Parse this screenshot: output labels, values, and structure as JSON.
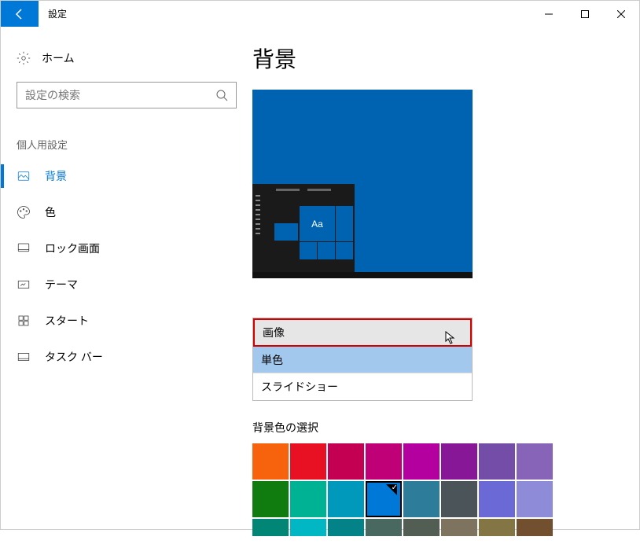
{
  "titlebar": {
    "title": "設定"
  },
  "sidebar": {
    "home": "ホーム",
    "search_placeholder": "設定の検索",
    "section": "個人用設定",
    "items": [
      {
        "label": "背景"
      },
      {
        "label": "色"
      },
      {
        "label": "ロック画面"
      },
      {
        "label": "テーマ"
      },
      {
        "label": "スタート"
      },
      {
        "label": "タスク バー"
      }
    ]
  },
  "main": {
    "title": "背景",
    "preview_tile_text": "Aa",
    "dropdown": {
      "options": [
        {
          "label": "画像"
        },
        {
          "label": "単色"
        },
        {
          "label": "スライドショー"
        }
      ]
    },
    "color_section_label": "背景色の選択",
    "colors_row1": [
      "#f7630c",
      "#e81123",
      "#c30052",
      "#bf0077",
      "#b4009e",
      "#881798",
      "#744da9",
      "#8764b8"
    ],
    "colors_row2": [
      "#107c10",
      "#00b294",
      "#0099bc",
      "#0078d7",
      "#2d7d9a",
      "#4a5459",
      "#6b69d6",
      "#8e8cd8"
    ],
    "colors_row3": [
      "#018574",
      "#00b7c3",
      "#038387",
      "#486860",
      "#525e54",
      "#7e735f",
      "#847545",
      "#724f2f"
    ],
    "selected_color_index": 11
  }
}
